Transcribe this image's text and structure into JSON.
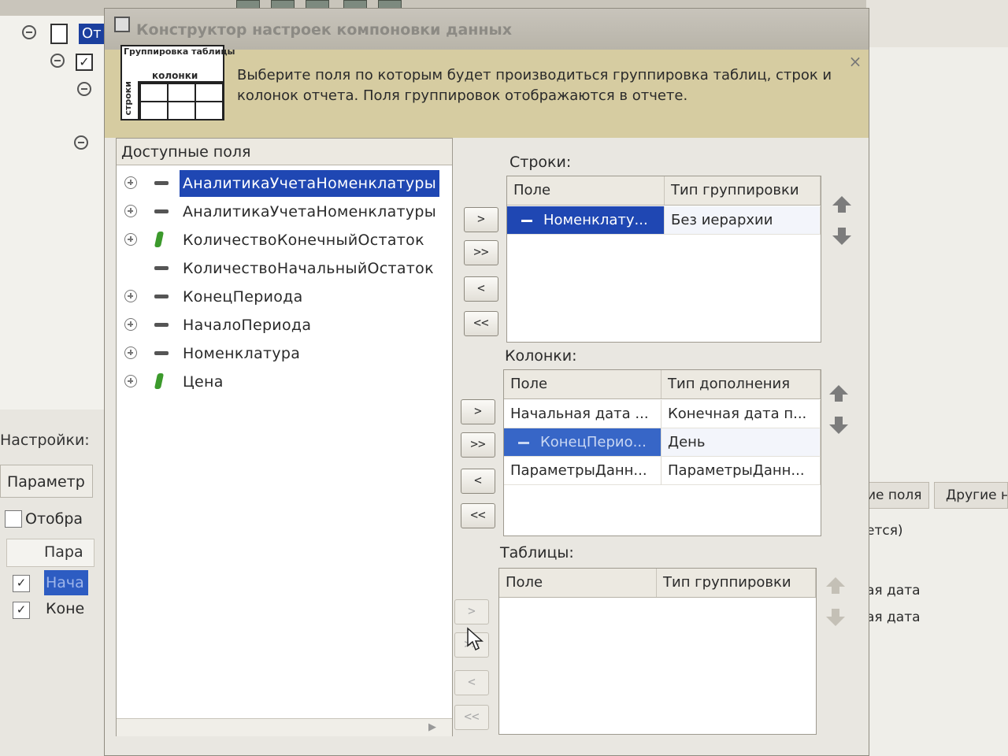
{
  "dialog": {
    "title": "Конструктор настроек компоновки данных",
    "close_label": "×",
    "description": "Выберите поля по которым будет производиться группировка таблиц, строк и колонок отчета. Поля группировок отображаются в отчете.",
    "header_icon": {
      "table_label": "Группировка таблицы",
      "columns_label": "колонки",
      "rows_label": "строки"
    }
  },
  "available_fields": {
    "title": "Доступные поля",
    "items": [
      {
        "label": "АналитикаУчетаНоменклатуры",
        "icon": "dash-icon",
        "expandable": true,
        "selected": true
      },
      {
        "label": "АналитикаУчетаНоменклатуры",
        "icon": "dash-icon",
        "expandable": true,
        "selected": false
      },
      {
        "label": "КоличествоКонечныйОстаток",
        "icon": "resource-icon",
        "expandable": true,
        "selected": false
      },
      {
        "label": "КоличествоНачальныйОстаток",
        "icon": "dash-icon",
        "expandable": false,
        "selected": false
      },
      {
        "label": "КонецПериода",
        "icon": "dash-icon",
        "expandable": true,
        "selected": false
      },
      {
        "label": "НачалоПериода",
        "icon": "dash-icon",
        "expandable": true,
        "selected": false
      },
      {
        "label": "Номенклатура",
        "icon": "dash-icon",
        "expandable": true,
        "selected": false
      },
      {
        "label": "Цена",
        "icon": "resource-icon",
        "expandable": true,
        "selected": false
      }
    ]
  },
  "buttons": {
    "add": ">",
    "add_all": ">>",
    "remove": "<",
    "remove_all": "<<"
  },
  "rows_group": {
    "label": "Строки:",
    "columns": [
      "Поле",
      "Тип группировки"
    ],
    "rows": [
      {
        "field": "Номенклату...",
        "type": "Без иерархии",
        "selected": true
      }
    ]
  },
  "columns_group": {
    "label": "Колонки:",
    "columns": [
      "Поле",
      "Тип дополнения"
    ],
    "rows": [
      {
        "field": "Начальная дата ...",
        "type": "Конечная дата п...",
        "selected": false
      },
      {
        "field": "КонецПерио...",
        "type": "День",
        "selected": true
      },
      {
        "field": "ПараметрыДанн...",
        "type": "ПараметрыДанн...",
        "selected": false
      }
    ]
  },
  "tables_group": {
    "label": "Таблицы:",
    "columns": [
      "Поле",
      "Тип группировки"
    ],
    "rows": []
  },
  "background": {
    "tree_item": "От",
    "settings_label": "Настройки:",
    "parameters_tab": "Параметр",
    "show_label": "Отобра",
    "param_col_header": "Пара",
    "param_rows": [
      "Нача",
      "Коне"
    ],
    "right_tabs": [
      "ие поля",
      "Другие н"
    ],
    "right_text": [
      "ется)",
      "ая дата",
      "ая дата"
    ]
  }
}
